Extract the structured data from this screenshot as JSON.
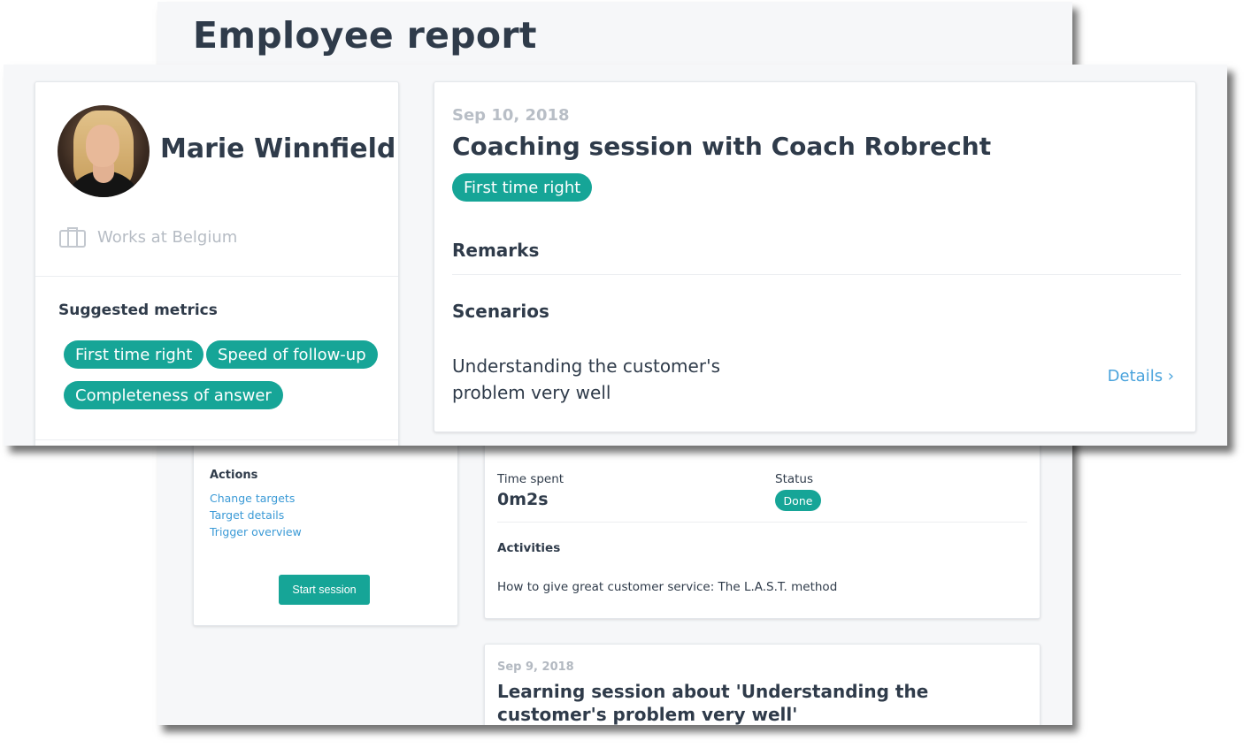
{
  "page": {
    "title": "Employee report"
  },
  "profile": {
    "name": "Marie Winnfield",
    "works_at": "Works at Belgium",
    "suggested_metrics_title": "Suggested metrics",
    "metrics": [
      "First time right",
      "Speed of follow-up",
      "Completeness of answer"
    ]
  },
  "session": {
    "date": "Sep 10, 2018",
    "title": "Coaching session with Coach Robrecht",
    "tag": "First time right",
    "remarks_title": "Remarks",
    "scenarios_title": "Scenarios",
    "scenario_text": "Understanding the customer's problem very well",
    "details_label": "Details ›"
  },
  "actions": {
    "title": "Actions",
    "links": [
      "Change targets",
      "Target details",
      "Trigger overview"
    ],
    "start_label": "Start session"
  },
  "session_summary": {
    "time_spent_label": "Time spent",
    "time_spent_value": "0m2s",
    "status_label": "Status",
    "status_value": "Done",
    "activities_label": "Activities",
    "activity": "How to give great customer service: The L.A.S.T. method"
  },
  "learning_session": {
    "date": "Sep 9, 2018",
    "title": "Learning session about 'Understanding the customer's problem very well'"
  },
  "colors": {
    "accent": "#16a597",
    "link": "#3b9ad6",
    "text": "#2f3b4a",
    "muted": "#b6bcc4"
  }
}
